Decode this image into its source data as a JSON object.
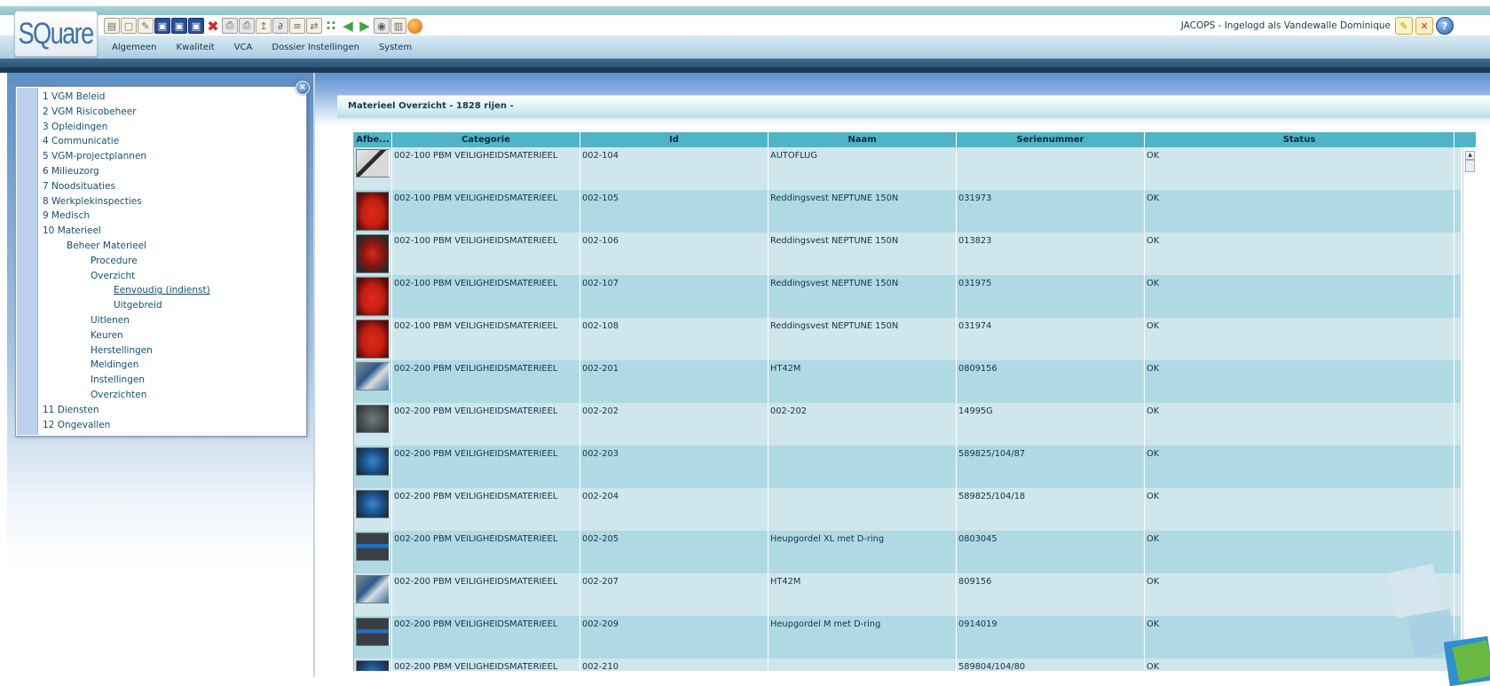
{
  "app": {
    "logo_text": "SQuare",
    "user_status": "JACOPS - Ingelogd als Vandewalle Dominique"
  },
  "toolbar": {
    "icons": [
      "new-document-icon",
      "copy-document-icon",
      "edit-document-icon",
      "save-icon",
      "save-as-icon",
      "save-all-icon",
      "delete-icon",
      "print-icon",
      "print-preview-icon",
      "export-icon",
      "attach-icon",
      "list-icon",
      "move-icon",
      "footsteps-icon",
      "back-icon",
      "forward-icon",
      "view-icon",
      "report-icon",
      "globe-icon"
    ]
  },
  "menu": {
    "items": [
      "Algemeen",
      "Kwaliteit",
      "VCA",
      "Dossier Instellingen",
      "System"
    ]
  },
  "nav": {
    "items": [
      {
        "label": "1 VGM Beleid",
        "level": 1
      },
      {
        "label": "2 VGM Risicobeheer",
        "level": 1
      },
      {
        "label": "3 Opleidingen",
        "level": 1
      },
      {
        "label": "4 Communicatie",
        "level": 1
      },
      {
        "label": "5 VGM-projectplannen",
        "level": 1
      },
      {
        "label": "6 Milieuzorg",
        "level": 1
      },
      {
        "label": "7 Noodsituaties",
        "level": 1
      },
      {
        "label": "8 Werkplekinspecties",
        "level": 1
      },
      {
        "label": "9 Medisch",
        "level": 1
      },
      {
        "label": "10 Materieel",
        "level": 1
      },
      {
        "label": "Beheer Materieel",
        "level": 2
      },
      {
        "label": "Procedure",
        "level": 3
      },
      {
        "label": "Overzicht",
        "level": 3
      },
      {
        "label": "Eenvoudig (indienst)",
        "level": 4,
        "active": true
      },
      {
        "label": "Uitgebreid",
        "level": 4
      },
      {
        "label": "Uitlenen",
        "level": 3
      },
      {
        "label": "Keuren",
        "level": 3
      },
      {
        "label": "Herstellingen",
        "level": 3
      },
      {
        "label": "Meldingen",
        "level": 3
      },
      {
        "label": "Instellingen",
        "level": 3
      },
      {
        "label": "Overzichten",
        "level": 3
      },
      {
        "label": "11 Diensten",
        "level": 1
      },
      {
        "label": "12 Ongevallen",
        "level": 1
      }
    ]
  },
  "panel": {
    "title": "Materieel Overzicht  - 1828 rijen -"
  },
  "table": {
    "columns": [
      "Afbe...",
      "Categorie",
      "Id",
      "Naam",
      "Serienummer",
      "Status"
    ],
    "rows": [
      {
        "thumb": "harness",
        "categorie": "002-100 PBM VEILIGHEIDSMATERIEEL",
        "id": "002-104",
        "naam": "AUTOFLUG",
        "serienummer": "",
        "status": "OK"
      },
      {
        "thumb": "vest",
        "categorie": "002-100 PBM VEILIGHEIDSMATERIEEL",
        "id": "002-105",
        "naam": "Reddingsvest NEPTUNE 150N",
        "serienummer": "031973",
        "status": "OK"
      },
      {
        "thumb": "vest2",
        "categorie": "002-100 PBM VEILIGHEIDSMATERIEEL",
        "id": "002-106",
        "naam": "Reddingsvest NEPTUNE 150N",
        "serienummer": "013823",
        "status": "OK"
      },
      {
        "thumb": "vest",
        "categorie": "002-100 PBM VEILIGHEIDSMATERIEEL",
        "id": "002-107",
        "naam": "Reddingsvest NEPTUNE 150N",
        "serienummer": "031975",
        "status": "OK"
      },
      {
        "thumb": "vest",
        "categorie": "002-100 PBM VEILIGHEIDSMATERIEEL",
        "id": "002-108",
        "naam": "Reddingsvest NEPTUNE 150N",
        "serienummer": "031974",
        "status": "OK"
      },
      {
        "thumb": "mixed",
        "categorie": "002-200 PBM VEILIGHEIDSMATERIEEL",
        "id": "002-201",
        "naam": "HT42M",
        "serienummer": "0809156",
        "status": "OK"
      },
      {
        "thumb": "dark",
        "categorie": "002-200 PBM VEILIGHEIDSMATERIEEL",
        "id": "002-202",
        "naam": "002-202",
        "serienummer": "14995G",
        "status": "OK"
      },
      {
        "thumb": "blue",
        "categorie": "002-200 PBM VEILIGHEIDSMATERIEEL",
        "id": "002-203",
        "naam": "",
        "serienummer": "589825/104/87",
        "status": "OK"
      },
      {
        "thumb": "blue",
        "categorie": "002-200 PBM VEILIGHEIDSMATERIEEL",
        "id": "002-204",
        "naam": "",
        "serienummer": "589825/104/18",
        "status": "OK"
      },
      {
        "thumb": "belt",
        "categorie": "002-200 PBM VEILIGHEIDSMATERIEEL",
        "id": "002-205",
        "naam": "Heupgordel XL met D-ring",
        "serienummer": "0803045",
        "status": "OK"
      },
      {
        "thumb": "mixed",
        "categorie": "002-200 PBM VEILIGHEIDSMATERIEEL",
        "id": "002-207",
        "naam": "HT42M",
        "serienummer": "809156",
        "status": "OK"
      },
      {
        "thumb": "belt",
        "categorie": "002-200 PBM VEILIGHEIDSMATERIEEL",
        "id": "002-209",
        "naam": "Heupgordel M met D-ring",
        "serienummer": "0914019",
        "status": "OK"
      },
      {
        "thumb": "blue",
        "categorie": "002-200 PBM VEILIGHEIDSMATERIEEL",
        "id": "002-210",
        "naam": "",
        "serienummer": "589804/104/80",
        "status": "OK"
      }
    ]
  },
  "colors": {
    "header_accent": "#4fb4c6",
    "row_odd": "#cfe6ec",
    "row_even": "#b0dae3",
    "menubar": "#a9cde0",
    "dark_band": "#1f3f5a"
  }
}
